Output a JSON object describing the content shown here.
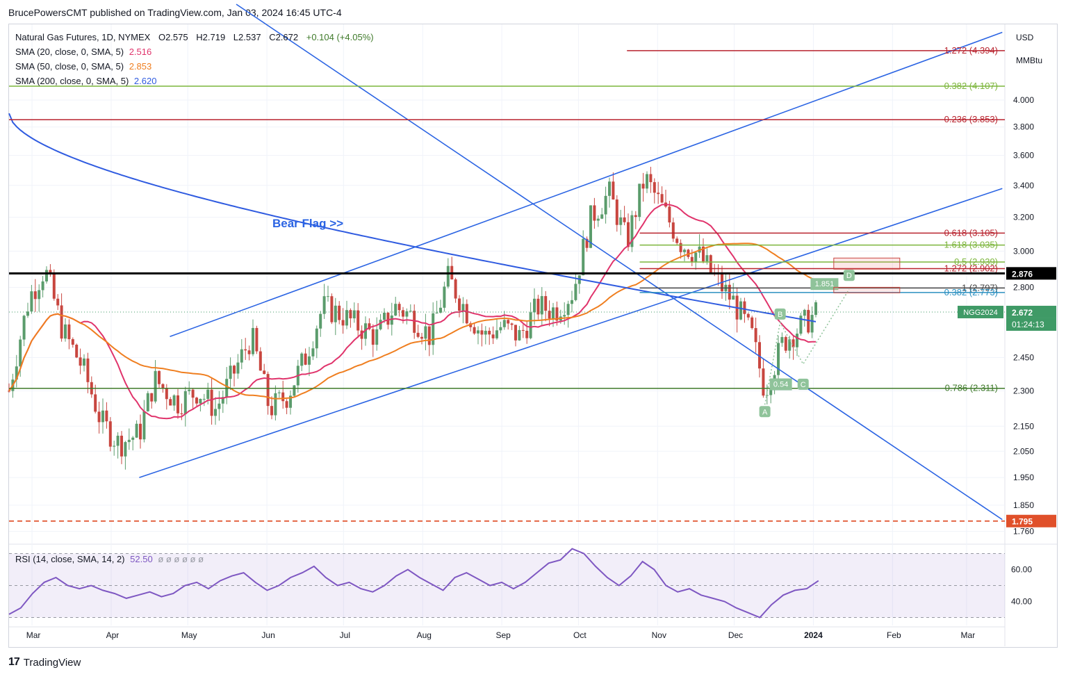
{
  "header": {
    "author": "BrucePowersCMT",
    "published_text": "published on TradingView.com, Jan 03, 2024 16:45 UTC-4"
  },
  "legend": {
    "symbol_line": "Natural Gas Futures, 1D, NYMEX",
    "ohlc": {
      "O": "O2.575",
      "H": "H2.719",
      "L": "L2.537",
      "C": "C2.672",
      "change": "+0.104 (+4.05%)"
    },
    "sma20_label": "SMA (20, close, 0, SMA, 5)",
    "sma20_value": "2.516",
    "sma50_label": "SMA (50, close, 0, SMA, 5)",
    "sma50_value": "2.853",
    "sma200_label": "SMA (200, close, 0, SMA, 5)",
    "sma200_value": "2.620",
    "rsi_label": "RSI (14, close, SMA, 14, 2)",
    "rsi_value": "52.50",
    "rsi_extra": "ø ø ø ø ø ø"
  },
  "currency": "USD",
  "unit": "MMBtu",
  "footer": {
    "brand": "TradingView"
  },
  "colors": {
    "up": "#5b9c6c",
    "down": "#c8463f",
    "sma20": "#e0336b",
    "sma50": "#ef7e1f",
    "sma200": "#2f5be0",
    "trend_blue": "#2b64e3",
    "fib_red": "#b8232e",
    "fib_green": "#7cb53b",
    "fib_dkgreen": "#3f7a2a",
    "fib_cyan": "#2a8fc0",
    "rsi": "#7e57c2",
    "last_price": "#3f9a66"
  },
  "chart_data": [
    {
      "type": "candlestick",
      "title": "Natural Gas Futures, 1D, NYMEX",
      "x_ticks": [
        "Mar",
        "Apr",
        "May",
        "Jun",
        "Jul",
        "Aug",
        "Sep",
        "Oct",
        "Nov",
        "Dec",
        "2024",
        "Feb",
        "Mar"
      ],
      "y_ticks": [
        1.76,
        1.85,
        1.95,
        2.05,
        2.15,
        2.3,
        2.45,
        2.8,
        3.0,
        3.2,
        3.4,
        3.6,
        3.8,
        4.0
      ],
      "y_scale": "log",
      "ylim": [
        1.72,
        4.62
      ],
      "price_path": [
        [
          "2023-02-20",
          2.3
        ],
        [
          "2023-02-28",
          2.75
        ],
        [
          "2023-03-06",
          2.9
        ],
        [
          "2023-03-13",
          2.58
        ],
        [
          "2023-03-21",
          2.4
        ],
        [
          "2023-03-28",
          2.17
        ],
        [
          "2023-04-04",
          2.08
        ],
        [
          "2023-04-12",
          2.12
        ],
        [
          "2023-04-18",
          2.35
        ],
        [
          "2023-04-27",
          2.25
        ],
        [
          "2023-05-05",
          2.3
        ],
        [
          "2023-05-12",
          2.22
        ],
        [
          "2023-05-19",
          2.38
        ],
        [
          "2023-05-26",
          2.55
        ],
        [
          "2023-06-02",
          2.22
        ],
        [
          "2023-06-09",
          2.28
        ],
        [
          "2023-06-16",
          2.45
        ],
        [
          "2023-06-23",
          2.7
        ],
        [
          "2023-06-30",
          2.66
        ],
        [
          "2023-07-07",
          2.6
        ],
        [
          "2023-07-14",
          2.55
        ],
        [
          "2023-07-21",
          2.7
        ],
        [
          "2023-07-28",
          2.65
        ],
        [
          "2023-08-04",
          2.55
        ],
        [
          "2023-08-11",
          2.85
        ],
        [
          "2023-08-18",
          2.68
        ],
        [
          "2023-08-25",
          2.55
        ],
        [
          "2023-09-01",
          2.6
        ],
        [
          "2023-09-08",
          2.55
        ],
        [
          "2023-09-15",
          2.7
        ],
        [
          "2023-09-22",
          2.68
        ],
        [
          "2023-09-29",
          2.78
        ],
        [
          "2023-10-06",
          3.2
        ],
        [
          "2023-10-13",
          3.35
        ],
        [
          "2023-10-20",
          3.05
        ],
        [
          "2023-10-27",
          3.45
        ],
        [
          "2023-11-03",
          3.25
        ],
        [
          "2023-11-10",
          3.05
        ],
        [
          "2023-11-17",
          2.98
        ],
        [
          "2023-11-24",
          2.84
        ],
        [
          "2023-12-01",
          2.72
        ],
        [
          "2023-12-08",
          2.55
        ],
        [
          "2023-12-13",
          2.3
        ],
        [
          "2023-12-20",
          2.52
        ],
        [
          "2023-12-27",
          2.6
        ],
        [
          "2024-01-03",
          2.672
        ]
      ],
      "sma20_last": 2.516,
      "sma50_last": 2.853,
      "sma200_last": 2.62,
      "horizontal_levels": [
        {
          "label": "1.272 (4.394)",
          "value": 4.394
        },
        {
          "label": "0.382 (4.107)",
          "value": 4.107
        },
        {
          "label": "0.236 (3.853)",
          "value": 3.853
        },
        {
          "label": "0.618 (3.105)",
          "value": 3.105
        },
        {
          "label": "1.618 (3.035)",
          "value": 3.035
        },
        {
          "label": "0.5 (2.939)",
          "value": 2.939
        },
        {
          "label": "1.272 (2.902)",
          "value": 2.902
        },
        {
          "label": "1 (2.797)",
          "value": 2.797
        },
        {
          "label": "0.382 (2.773)",
          "value": 2.773
        },
        {
          "label": "0.786 (2.311)",
          "value": 2.311
        }
      ],
      "price_labels": [
        {
          "label": "2.876",
          "value": 2.876
        },
        {
          "label": "1.795",
          "value": 1.795
        },
        {
          "label": "2.672",
          "value": 2.672
        }
      ],
      "annotations": [
        "Bear Flag >>",
        "A",
        "B",
        "C",
        "D",
        "1.851",
        "0.54",
        "NGG2024",
        "01:24:13"
      ]
    },
    {
      "type": "line",
      "title": "RSI (14, close, SMA, 14, 2)",
      "y_ticks": [
        40.0,
        60.0
      ],
      "ylim": [
        25,
        75
      ],
      "last_value": 52.5,
      "values": [
        32,
        36,
        45,
        52,
        55,
        50,
        48,
        50,
        47,
        45,
        42,
        44,
        46,
        43,
        45,
        50,
        52,
        48,
        53,
        56,
        58,
        52,
        47,
        50,
        55,
        58,
        62,
        55,
        50,
        52,
        48,
        46,
        50,
        56,
        60,
        55,
        51,
        47,
        55,
        58,
        54,
        50,
        52,
        48,
        52,
        58,
        64,
        66,
        73,
        70,
        62,
        55,
        50,
        56,
        65,
        60,
        50,
        46,
        48,
        44,
        42,
        40,
        36,
        33,
        30,
        38,
        44,
        47,
        48,
        53
      ]
    }
  ]
}
